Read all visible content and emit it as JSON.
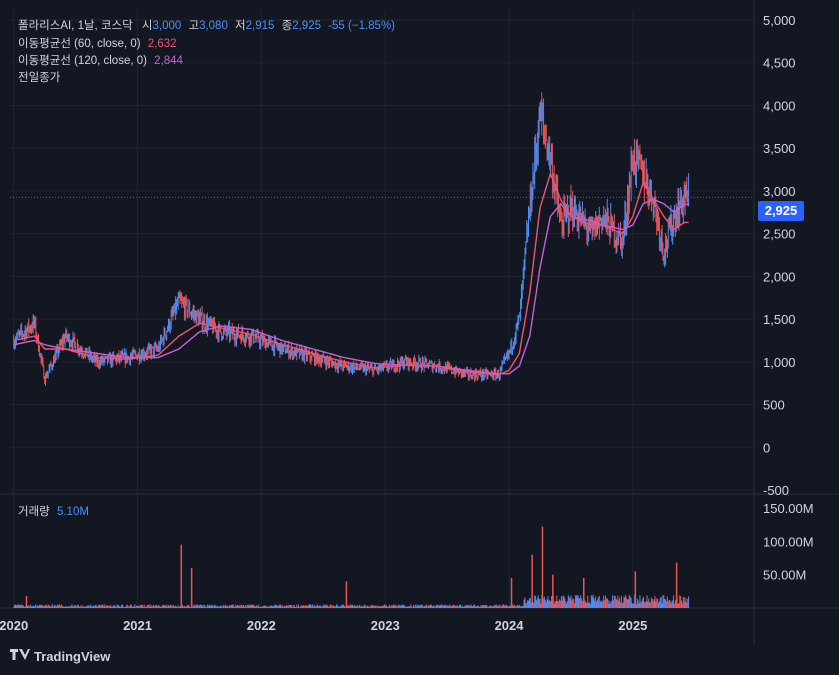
{
  "legend": {
    "symbol": "폴라리스AI, 1날, 코스닥",
    "open_label": "시",
    "open": "3,000",
    "high_label": "고",
    "high": "3,080",
    "low_label": "저",
    "low": "2,915",
    "close_label": "종",
    "close": "2,925",
    "change": "-55 (−1.85%)",
    "ma60_label": "이동평균선 (60, close, 0)",
    "ma60_value": "2,632",
    "ma120_label": "이동평균선 (120, close, 0)",
    "ma120_value": "2,844",
    "prev_close_label": "전일종가",
    "volume_label": "거래량",
    "volume_value": "5.10M"
  },
  "price_tag": "2,925",
  "brand": "TradingView",
  "colors": {
    "background": "#131722",
    "up": "#4f8ef7",
    "down": "#ef5350",
    "ma60": "#ef5373",
    "ma120": "#c561d6",
    "price_line": "#2962ff"
  },
  "chart_data": [
    {
      "type": "line",
      "title": "폴라리스AI, 1날, 코스닥",
      "x": [
        "2020-01",
        "2020-03",
        "2020-04",
        "2020-06",
        "2020-09",
        "2020-12",
        "2021-03",
        "2021-05",
        "2021-07",
        "2021-09",
        "2021-12",
        "2022-03",
        "2022-06",
        "2022-09",
        "2022-12",
        "2023-03",
        "2023-06",
        "2023-09",
        "2023-12",
        "2024-01",
        "2024-02",
        "2024-03",
        "2024-04",
        "2024-05",
        "2024-06",
        "2024-07",
        "2024-09",
        "2024-10",
        "2024-12",
        "2025-01",
        "2025-02",
        "2025-03",
        "2025-04",
        "2025-05",
        "2025-06"
      ],
      "series": [
        {
          "name": "close",
          "values": [
            1250,
            1450,
            800,
            1300,
            1000,
            1050,
            1150,
            1700,
            1500,
            1350,
            1300,
            1150,
            1050,
            950,
            900,
            1000,
            950,
            850,
            850,
            1100,
            1500,
            2800,
            3900,
            3400,
            2600,
            2800,
            2500,
            2700,
            2400,
            3400,
            3200,
            2900,
            2300,
            2700,
            2925
          ]
        },
        {
          "name": "이동평균선 (60, close, 0)",
          "values": [
            1250,
            1300,
            1150,
            1150,
            1050,
            1030,
            1080,
            1300,
            1450,
            1400,
            1320,
            1200,
            1100,
            1000,
            930,
            960,
            950,
            880,
            850,
            900,
            1100,
            1800,
            2800,
            3200,
            2900,
            2700,
            2600,
            2600,
            2500,
            2700,
            3100,
            2900,
            2700,
            2550,
            2632
          ]
        },
        {
          "name": "이동평균선 (120, close, 0)",
          "values": [
            1200,
            1250,
            1200,
            1150,
            1100,
            1050,
            1050,
            1150,
            1350,
            1420,
            1380,
            1250,
            1150,
            1050,
            980,
            960,
            950,
            900,
            860,
            860,
            950,
            1300,
            2100,
            2700,
            2850,
            2700,
            2650,
            2600,
            2550,
            2600,
            2850,
            2900,
            2850,
            2750,
            2844
          ]
        }
      ],
      "ylim": [
        -500,
        5000
      ],
      "yticks": [
        "5,000",
        "4,500",
        "4,000",
        "3,500",
        "3,000",
        "2,500",
        "2,000",
        "1,500",
        "1,000",
        "500",
        "0",
        "-500"
      ],
      "xticks": [
        "2020",
        "2021",
        "2022",
        "2023",
        "2024",
        "2025"
      ],
      "grid": true
    },
    {
      "type": "bar",
      "title": "거래량",
      "yticks": [
        "150.00M",
        "100.00M",
        "50.00M"
      ],
      "ylim": [
        0,
        150
      ],
      "spikes": [
        {
          "x": "2020-02",
          "value": 18
        },
        {
          "x": "2021-05",
          "value": 95
        },
        {
          "x": "2021-06",
          "value": 60
        },
        {
          "x": "2022-09",
          "value": 40
        },
        {
          "x": "2024-01",
          "value": 45
        },
        {
          "x": "2024-03",
          "value": 80
        },
        {
          "x": "2024-04",
          "value": 122
        },
        {
          "x": "2024-05",
          "value": 50
        },
        {
          "x": "2024-08",
          "value": 45
        },
        {
          "x": "2025-01",
          "value": 55
        },
        {
          "x": "2025-05",
          "value": 68
        }
      ]
    }
  ]
}
